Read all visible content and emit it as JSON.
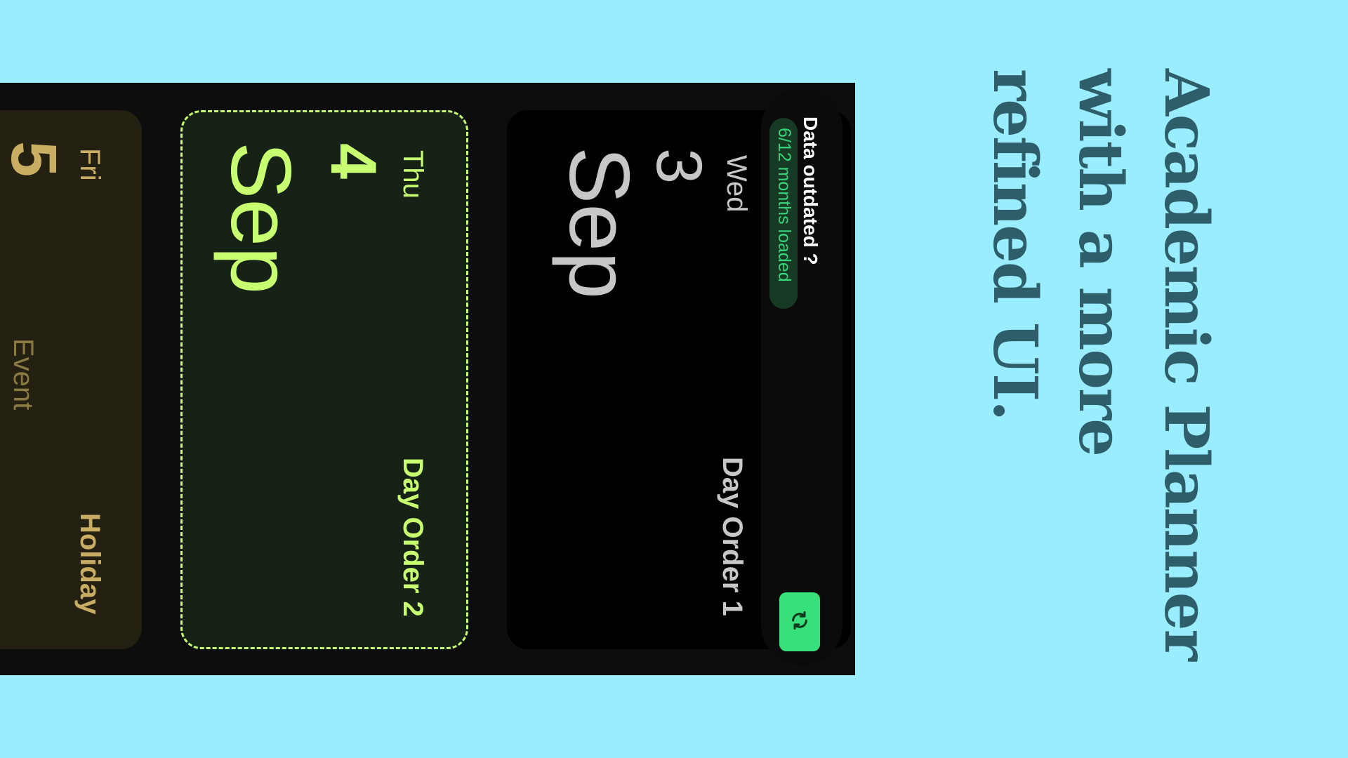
{
  "headline": "Academic Planner with a more refined UI.",
  "banner": {
    "title": "Data outdated ?",
    "months_loaded": "6/12 months loaded",
    "refresh_icon": "refresh-icon"
  },
  "days": {
    "wed": {
      "weekday": "Wed",
      "date": "3",
      "month": "Sep",
      "day_order": "Day Order 1"
    },
    "thu": {
      "weekday": "Thu",
      "date": "4",
      "month": "Sep",
      "day_order": "Day Order 2"
    },
    "fri": {
      "weekday": "Fri",
      "date": "5",
      "status": "Holiday",
      "event": "Event"
    }
  },
  "colors": {
    "background": "#9aedfe",
    "headline": "#2d5e69",
    "today_accent": "#c8ff70",
    "holiday_accent": "#c8ad62",
    "refresh_button": "#38e07b",
    "loaded_text": "#38d47a"
  }
}
